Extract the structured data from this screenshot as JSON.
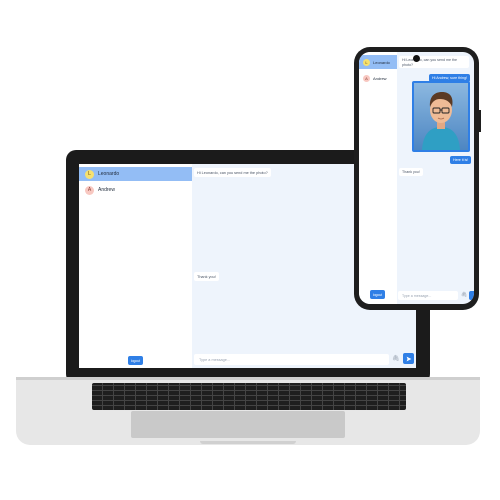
{
  "laptop": {
    "users": [
      {
        "initial": "L",
        "name": "Leonardo"
      },
      {
        "initial": "A",
        "name": "Andrew"
      }
    ],
    "logout_label": "logout",
    "messages": [
      {
        "text": "Hi Leonardo, can you send me the photo?"
      },
      {
        "text": "Thank you!"
      }
    ],
    "input_placeholder": "Type a message...",
    "attach_icon": "paperclip-icon",
    "send_icon": "send-icon"
  },
  "phone": {
    "users": [
      {
        "initial": "L",
        "name": "Leonardo"
      },
      {
        "initial": "A",
        "name": "Andrew"
      }
    ],
    "logout_label": "logout",
    "messages": [
      {
        "text": "Hi Leonardo, can you send me the photo?"
      },
      {
        "text": "Hi Andrew, sure thing!"
      },
      {
        "text": "Here it is!"
      },
      {
        "text": "Thank you!"
      }
    ],
    "input_placeholder": "Type a message...",
    "attach_icon": "paperclip-icon"
  },
  "colors": {
    "accent": "#2f7fe6",
    "active_user": "#93bdf5",
    "chat_bg": "#eef4fc"
  }
}
